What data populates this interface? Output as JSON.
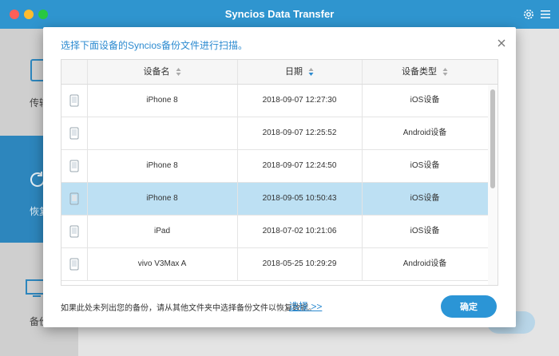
{
  "window": {
    "title": "Syncios Data Transfer"
  },
  "sidebar": {
    "items": [
      {
        "label": "传输",
        "icon": "tablet-icon"
      },
      {
        "label": "恢复",
        "icon": "restore-icon"
      },
      {
        "label": "备份",
        "icon": "monitor-icon"
      }
    ]
  },
  "dialog": {
    "title": "选择下面设备的Syncios备份文件进行扫描。",
    "columns": {
      "name": "设备名",
      "date": "日期",
      "type": "设备类型"
    },
    "rows": [
      {
        "name": "iPhone 8",
        "date": "2018-09-07 12:27:30",
        "type": "iOS设备"
      },
      {
        "name": "",
        "date": "2018-09-07 12:25:52",
        "type": "Android设备"
      },
      {
        "name": "iPhone 8",
        "date": "2018-09-07 12:24:50",
        "type": "iOS设备"
      },
      {
        "name": "iPhone 8",
        "date": "2018-09-05 10:50:43",
        "type": "iOS设备"
      },
      {
        "name": "iPad",
        "date": "2018-07-02 10:21:06",
        "type": "iOS设备"
      },
      {
        "name": "vivo V3Max A",
        "date": "2018-05-25 10:29:29",
        "type": "Android设备"
      }
    ],
    "selected_row": 3,
    "footer_text": "如果此处未列出您的备份，请从其他文件夹中选择备份文件以恢复数据。",
    "choose_link": "选择 >>",
    "confirm_button": "确定"
  },
  "colors": {
    "accent": "#2b95d6",
    "titlebar": "#2f95cf",
    "selected_row": "#bde0f3"
  }
}
